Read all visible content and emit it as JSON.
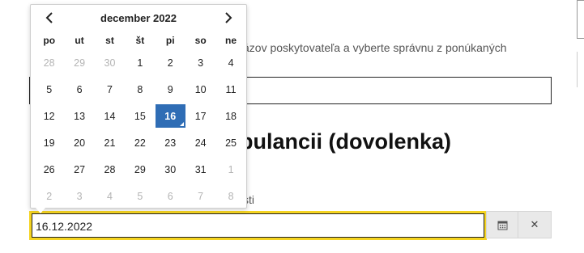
{
  "background": {
    "instruction_text": "ázov poskytovateľa a vyberte správnu z ponúkaných",
    "heading": "bulancii (dovolenka)",
    "field_label": "sti"
  },
  "date_field": {
    "value": "16.12.2022",
    "calendar_button_icon": "calendar-icon",
    "clear_button_label": "✕"
  },
  "calendar": {
    "title": "december 2022",
    "weekdays": [
      "po",
      "ut",
      "st",
      "št",
      "pi",
      "so",
      "ne"
    ],
    "selected_day": "16",
    "weeks": [
      [
        {
          "d": "28",
          "m": true
        },
        {
          "d": "29",
          "m": true
        },
        {
          "d": "30",
          "m": true
        },
        {
          "d": "1"
        },
        {
          "d": "2"
        },
        {
          "d": "3"
        },
        {
          "d": "4"
        }
      ],
      [
        {
          "d": "5"
        },
        {
          "d": "6"
        },
        {
          "d": "7"
        },
        {
          "d": "8"
        },
        {
          "d": "9"
        },
        {
          "d": "10"
        },
        {
          "d": "11"
        }
      ],
      [
        {
          "d": "12"
        },
        {
          "d": "13"
        },
        {
          "d": "14"
        },
        {
          "d": "15"
        },
        {
          "d": "16",
          "s": true
        },
        {
          "d": "17"
        },
        {
          "d": "18"
        }
      ],
      [
        {
          "d": "19"
        },
        {
          "d": "20"
        },
        {
          "d": "21"
        },
        {
          "d": "22"
        },
        {
          "d": "23"
        },
        {
          "d": "24"
        },
        {
          "d": "25"
        }
      ],
      [
        {
          "d": "26"
        },
        {
          "d": "27"
        },
        {
          "d": "28"
        },
        {
          "d": "29"
        },
        {
          "d": "30"
        },
        {
          "d": "31"
        },
        {
          "d": "1",
          "m": true
        }
      ],
      [
        {
          "d": "2",
          "m": true
        },
        {
          "d": "3",
          "m": true
        },
        {
          "d": "4",
          "m": true
        },
        {
          "d": "5",
          "m": true
        },
        {
          "d": "6",
          "m": true
        },
        {
          "d": "7",
          "m": true
        },
        {
          "d": "8",
          "m": true
        }
      ]
    ]
  },
  "colors": {
    "selected_day": "#2f6db5",
    "focus_outline": "#f5d421",
    "muted_day": "#b4b4b4"
  }
}
